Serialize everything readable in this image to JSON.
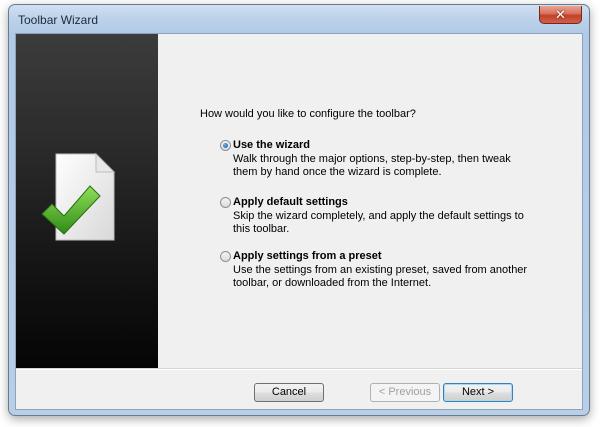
{
  "window": {
    "title": "Toolbar Wizard",
    "close_symbol": "✕"
  },
  "wizard": {
    "question": "How would you like to configure the toolbar?",
    "options": [
      {
        "title": "Use the wizard",
        "description": "Walk through the major options, step-by-step, then tweak them by hand once the wizard is complete.",
        "selected": true
      },
      {
        "title": "Apply default settings",
        "description": "Skip the wizard completely, and apply the default settings to this toolbar.",
        "selected": false
      },
      {
        "title": "Apply settings from a preset",
        "description": "Use the settings from an existing preset, saved from another toolbar, or downloaded from the Internet.",
        "selected": false
      }
    ]
  },
  "buttons": {
    "cancel": "Cancel",
    "previous": "< Previous",
    "next": "Next >"
  },
  "icons": {
    "sidebar": "document-checkmark-icon",
    "close": "close-icon"
  },
  "colors": {
    "sidebar_dark": "#141414",
    "check_green": "#58b228"
  }
}
